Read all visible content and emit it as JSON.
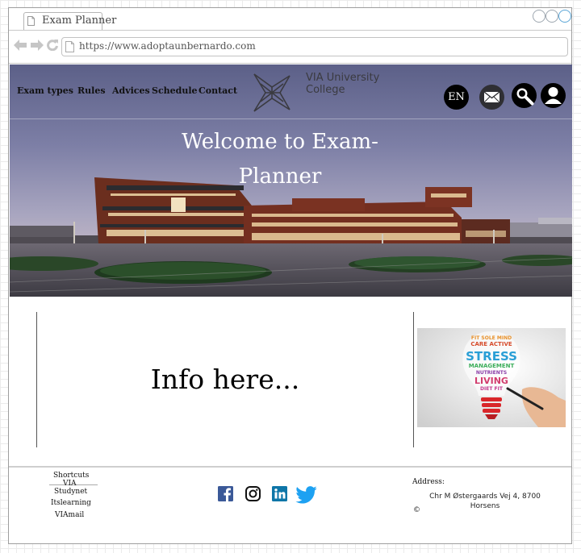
{
  "browser": {
    "tab_title": "Exam Planner",
    "url": "https://www.adoptaunbernardo.com"
  },
  "nav": {
    "items": [
      "Exam types",
      "Rules",
      "Advices",
      "Schedule",
      "Contact"
    ]
  },
  "logo": {
    "line1": "VIA University",
    "line2": "College"
  },
  "header_actions": {
    "language_label": "EN",
    "icons": [
      "mail-icon",
      "search-icon",
      "user-icon"
    ]
  },
  "hero": {
    "title": "Welcome to Exam-Planner"
  },
  "main": {
    "info_text": "Info here..."
  },
  "footer": {
    "shortcuts_heading": "Shortcuts",
    "shortcuts": [
      "VIA",
      "Studynet",
      "Itslearning",
      "VIAmail"
    ],
    "social_icons": [
      "facebook-icon",
      "instagram-icon",
      "linkedin-icon",
      "twitter-icon"
    ],
    "address_label": "Address:",
    "address": "Chr M Østergaards Vej 4, 8700 Horsens",
    "copyright": "©"
  },
  "colors": {
    "facebook": "#3b5998",
    "linkedin": "#0e76a8",
    "twitter": "#1da1f2"
  }
}
